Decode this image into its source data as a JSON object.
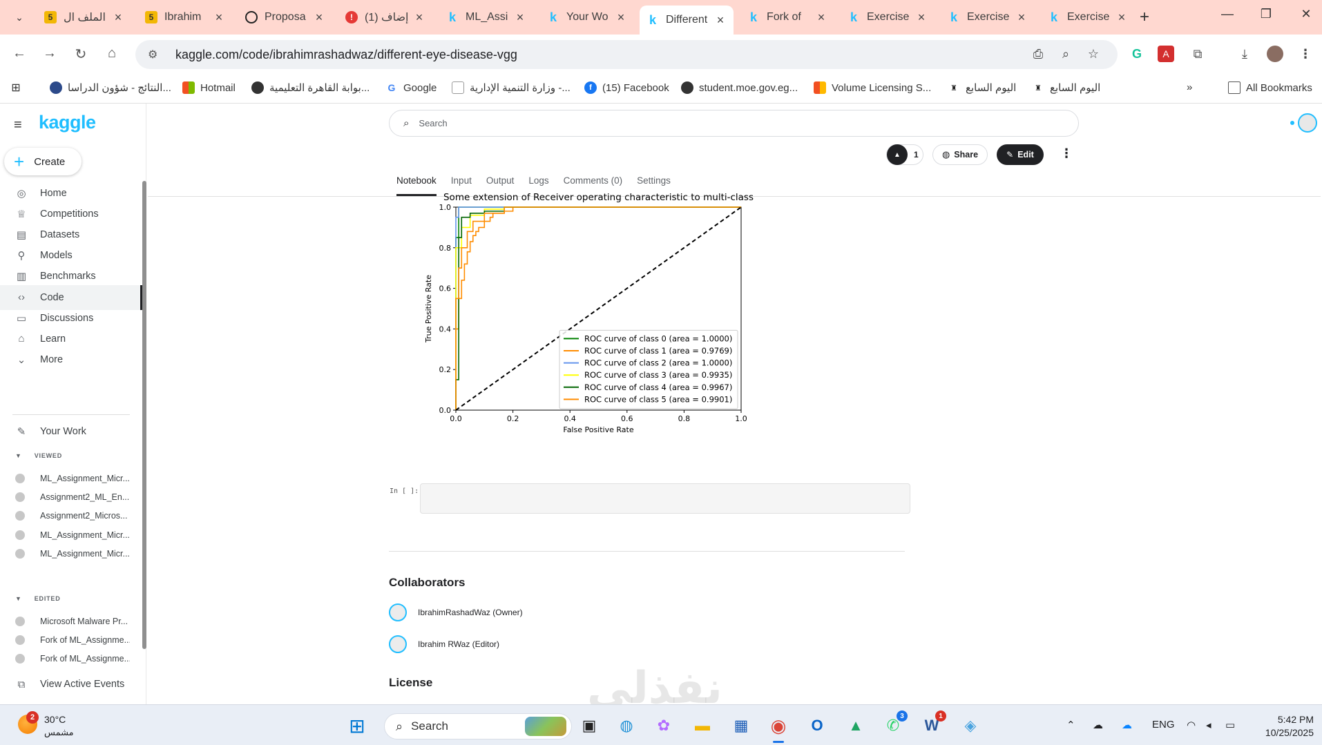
{
  "browser": {
    "tabs": [
      {
        "label": "الملف ال",
        "favicon": "5"
      },
      {
        "label": "Ibrahim",
        "favicon": "5"
      },
      {
        "label": "Proposa",
        "favicon": "openai-icon"
      },
      {
        "label": "(1) إضاف",
        "favicon": "notification-icon"
      },
      {
        "label": "ML_Assi",
        "favicon": "k"
      },
      {
        "label": "Your Wo",
        "favicon": "k"
      },
      {
        "label": "Different",
        "favicon": "k",
        "active": true
      },
      {
        "label": "Fork of",
        "favicon": "k"
      },
      {
        "label": "Exercise",
        "favicon": "k"
      },
      {
        "label": "Exercise",
        "favicon": "k"
      },
      {
        "label": "Exercise",
        "favicon": "k"
      }
    ],
    "url": "kaggle.com/code/ibrahimrashadwaz/different-eye-disease-vgg",
    "bookmarks": [
      "النتائج - شؤون الدراسا...",
      "Hotmail",
      "بوابة القاهرة التعليمية...",
      "Google",
      "وزارة التنمية الإدارية -...",
      "(15) Facebook",
      "student.moe.gov.eg...",
      "Volume Licensing S...",
      "اليوم السابع",
      "اليوم السابع"
    ],
    "all_bookmarks": "All Bookmarks"
  },
  "sidebar": {
    "logo": "kaggle",
    "create": "Create",
    "nav": [
      {
        "label": "Home",
        "icon": "compass-icon"
      },
      {
        "label": "Competitions",
        "icon": "trophy-icon"
      },
      {
        "label": "Datasets",
        "icon": "table-icon"
      },
      {
        "label": "Models",
        "icon": "models-icon"
      },
      {
        "label": "Benchmarks",
        "icon": "bar-chart-icon"
      },
      {
        "label": "Code",
        "icon": "code-icon",
        "selected": true
      },
      {
        "label": "Discussions",
        "icon": "comments-icon"
      },
      {
        "label": "Learn",
        "icon": "school-icon"
      },
      {
        "label": "More",
        "icon": "chevron-down-icon"
      }
    ],
    "your_work": "Your Work",
    "viewed_label": "VIEWED",
    "viewed": [
      "ML_Assignment_Micr...",
      "Assignment2_ML_En...",
      "Assignment2_Micros...",
      "ML_Assignment_Micr...",
      "ML_Assignment_Micr..."
    ],
    "edited_label": "EDITED",
    "edited": [
      "Microsoft Malware Pr...",
      "Fork of ML_Assignme...",
      "Fork of ML_Assignme..."
    ],
    "view_events": "View Active Events"
  },
  "header": {
    "search_placeholder": "Search",
    "vote_count": "1",
    "share": "Share",
    "edit": "Edit",
    "tabs": [
      "Notebook",
      "Input",
      "Output",
      "Logs",
      "Comments (0)",
      "Settings"
    ],
    "active_tab": "Notebook"
  },
  "chart_data": {
    "type": "line",
    "title": "Some extension of Receiver operating characteristic to multi-class",
    "xlabel": "False Positive Rate",
    "ylabel": "True Positive Rate",
    "xlim": [
      0.0,
      1.0
    ],
    "ylim": [
      0.0,
      1.0
    ],
    "xticks": [
      "0.0",
      "0.2",
      "0.4",
      "0.6",
      "0.8",
      "1.0"
    ],
    "yticks": [
      "0.0",
      "0.2",
      "0.4",
      "0.6",
      "0.8",
      "1.0"
    ],
    "grid": false,
    "legend_position": "lower right",
    "series": [
      {
        "name": "ROC curve of class 0 (area = 1.0000)",
        "color": "#008000",
        "x": [
          0,
          0,
          0.01,
          1
        ],
        "y": [
          0,
          0.85,
          1.0,
          1.0
        ]
      },
      {
        "name": "ROC curve of class 1 (area = 0.9769)",
        "color": "#ff8c00",
        "x": [
          0,
          0.0,
          0.01,
          0.02,
          0.03,
          0.04,
          0.05,
          0.06,
          0.07,
          0.08,
          0.1,
          0.12,
          0.13,
          0.17,
          0.2,
          1
        ],
        "y": [
          0,
          0.4,
          0.55,
          0.64,
          0.72,
          0.78,
          0.83,
          0.86,
          0.88,
          0.9,
          0.93,
          0.95,
          0.97,
          0.98,
          1.0,
          1.0
        ]
      },
      {
        "name": "ROC curve of class 2 (area = 1.0000)",
        "color": "#6495ed",
        "x": [
          0,
          0,
          0.01,
          1
        ],
        "y": [
          0,
          0.95,
          1.0,
          1.0
        ]
      },
      {
        "name": "ROC curve of class 3 (area = 0.9935)",
        "color": "#ffff00",
        "x": [
          0,
          0,
          0.02,
          0.05,
          0.1,
          0.17,
          1
        ],
        "y": [
          0,
          0.8,
          0.9,
          0.96,
          0.99,
          1.0,
          1.0
        ]
      },
      {
        "name": "ROC curve of class 4 (area = 0.9967)",
        "color": "#006400",
        "x": [
          0,
          0,
          0.01,
          0.02,
          0.05,
          0.1,
          0.17,
          1
        ],
        "y": [
          0,
          0.15,
          0.85,
          0.95,
          0.97,
          0.98,
          1.0,
          1.0
        ]
      },
      {
        "name": "ROC curve of class 5 (area = 0.9901)",
        "color": "#ff8c00",
        "x": [
          0,
          0,
          0.01,
          0.02,
          0.04,
          0.06,
          0.1,
          0.17,
          1
        ],
        "y": [
          0,
          0.55,
          0.7,
          0.8,
          0.88,
          0.93,
          0.97,
          1.0,
          1.0
        ]
      },
      {
        "name": "",
        "color": "#000000",
        "style": "dashed",
        "x": [
          0,
          1
        ],
        "y": [
          0,
          1
        ]
      }
    ]
  },
  "cell": {
    "prompt": "In [ ]:"
  },
  "collaborators": {
    "heading": "Collaborators",
    "people": [
      "IbrahimRashadWaz (Owner)",
      "Ibrahim RWaz (Editor)"
    ]
  },
  "license": {
    "heading": "License"
  },
  "watermark": "نفذلي",
  "taskbar": {
    "temp": "30°C",
    "condition": "مشمس",
    "weather_badge": "2",
    "search": "Search",
    "whatsapp_badge": "3",
    "app_badge": "1",
    "lang": "ENG",
    "time": "5:42 PM",
    "date": "10/25/2025"
  }
}
